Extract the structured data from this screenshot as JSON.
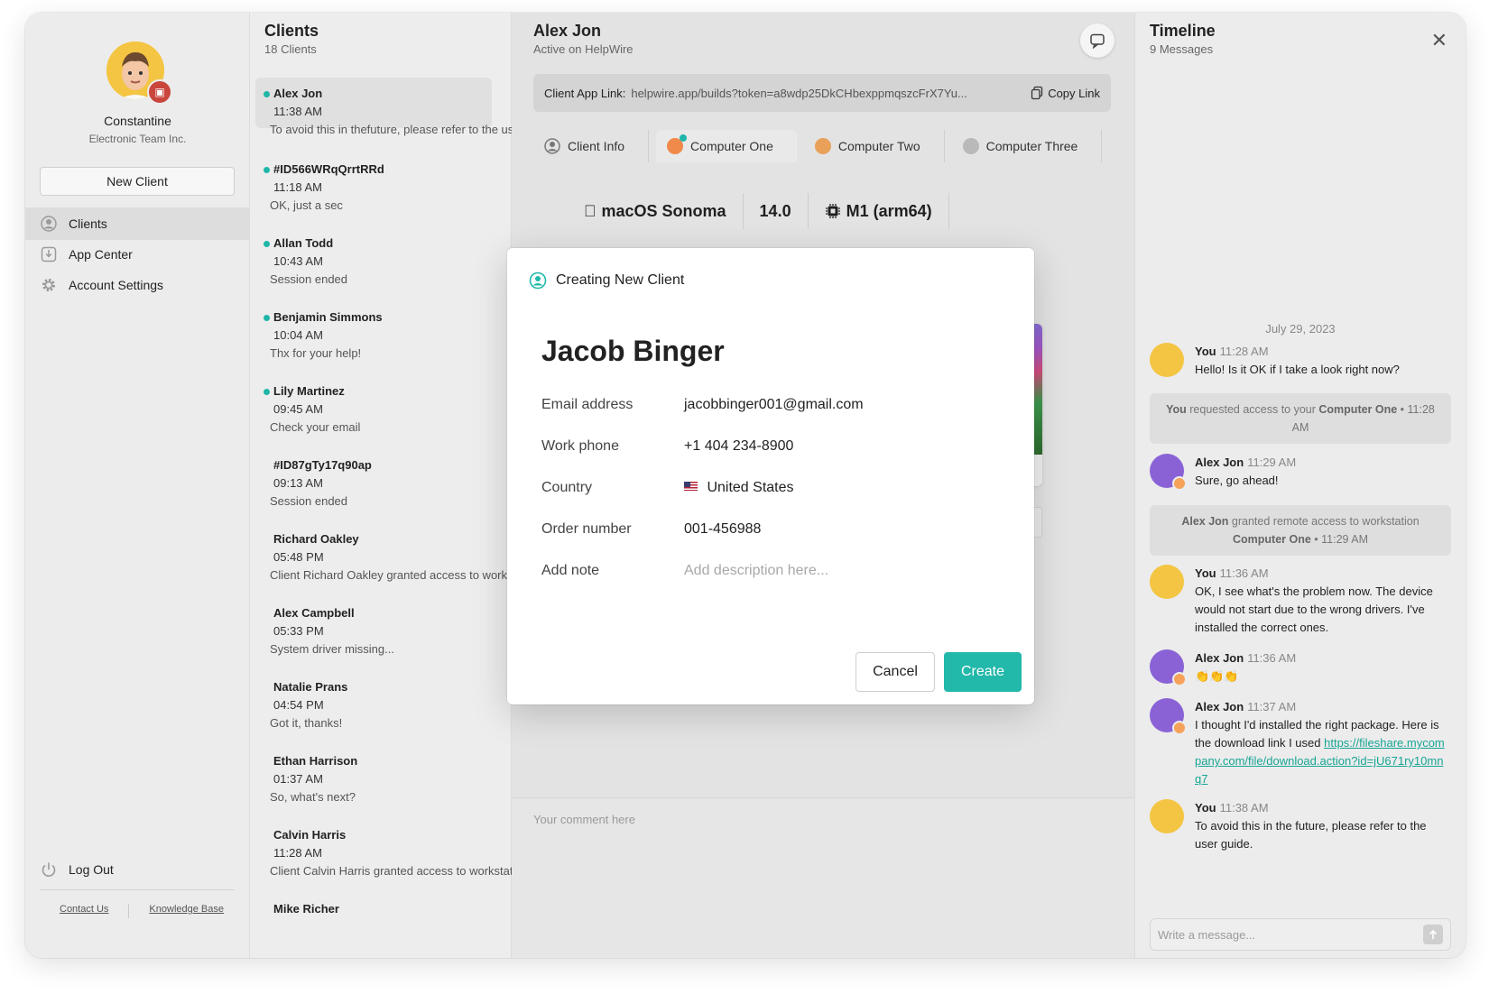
{
  "profile": {
    "name": "Constantine",
    "org": "Electronic Team Inc."
  },
  "sidebar": {
    "new_client": "New Client",
    "nav": [
      {
        "label": "Clients",
        "icon": "user-circle-icon"
      },
      {
        "label": "App Center",
        "icon": "download-icon"
      },
      {
        "label": "Account Settings",
        "icon": "gear-icon"
      }
    ],
    "logout": "Log Out",
    "footer": {
      "contact": "Contact Us",
      "kb": "Knowledge Base"
    }
  },
  "clients": {
    "title": "Clients",
    "count": "18 Clients",
    "items": [
      {
        "name": "Alex Jon",
        "time": "11:38 AM",
        "msg": "To avoid this in thefuture, please refer to the user guide",
        "online": true
      },
      {
        "name": "#ID566WRqQrrtRRd",
        "time": "11:18 AM",
        "msg": "OK, just a sec",
        "online": true
      },
      {
        "name": "Allan Todd",
        "time": "10:43 AM",
        "msg": "Session ended",
        "online": true
      },
      {
        "name": "Benjamin Simmons",
        "time": "10:04 AM",
        "msg": "Thx for your help!",
        "online": true
      },
      {
        "name": "Lily Martinez",
        "time": "09:45 AM",
        "msg": "Check your email",
        "online": true
      },
      {
        "name": "#ID87gTy17q90ap",
        "time": "09:13 AM",
        "msg": "Session ended",
        "online": false
      },
      {
        "name": "Richard Oakley",
        "time": "05:48 PM",
        "msg": "Client Richard Oakley granted access to workstation",
        "online": false
      },
      {
        "name": "Alex Campbell",
        "time": "05:33 PM",
        "msg": "System driver missing...",
        "online": false
      },
      {
        "name": "Natalie Prans",
        "time": "04:54 PM",
        "msg": "Got it, thanks!",
        "online": false
      },
      {
        "name": "Ethan Harrison",
        "time": "01:37 AM",
        "msg": "So, what's next?",
        "online": false
      },
      {
        "name": "Calvin Harris",
        "time": "11:28 AM",
        "msg": "Client Calvin Harris granted access to workstation",
        "online": false
      },
      {
        "name": "Mike Richer",
        "time": "",
        "msg": "",
        "online": false
      }
    ]
  },
  "main": {
    "name": "Alex Jon",
    "status": "Active on HelpWire",
    "link_label": "Client App Link:",
    "link_url": "helpwire.app/builds?token=a8wdp25DkCHbexppmqszcFrX7Yu...",
    "copy": "Copy Link",
    "tabs": [
      "Client Info",
      "Computer One",
      "Computer Two",
      "Computer Three"
    ],
    "specs": {
      "os": "macOS Sonoma",
      "version": "14.0",
      "chip": "M1 (arm64)"
    },
    "comment_placeholder": "Your comment here"
  },
  "modal": {
    "header": "Creating New Client",
    "name": "Jacob Binger",
    "fields": [
      {
        "label": "Email address",
        "value": "jacobbinger001@gmail.com"
      },
      {
        "label": "Work phone",
        "value": "+1 404 234-8900"
      },
      {
        "label": "Country",
        "value": "United States",
        "flag": "🇺🇸"
      },
      {
        "label": "Order number",
        "value": "001-456988"
      },
      {
        "label": "Add note",
        "placeholder": "Add description here..."
      }
    ],
    "cancel": "Cancel",
    "create": "Create"
  },
  "timeline": {
    "title": "Timeline",
    "count": "9 Messages",
    "date": "July 29, 2023",
    "messages": [
      {
        "who": "You",
        "time": "11:28 AM",
        "text": "Hello! Is it OK if I take a look right now?"
      },
      {
        "sys_pre": "You",
        "sys_mid": " requested access to your ",
        "sys_b": "Computer One",
        "sys_post": " • 11:28 AM"
      },
      {
        "who": "Alex Jon",
        "time": "11:29 AM",
        "text": "Sure, go ahead!"
      },
      {
        "sys_pre": "Alex Jon",
        "sys_mid": " granted remote access to workstation ",
        "sys_b": "Computer One",
        "sys_post": " • 11:29 AM"
      },
      {
        "who": "You",
        "time": "11:36 AM",
        "text": "OK, I see what's the problem now. The device would not start due to the wrong drivers. I've installed the correct ones."
      },
      {
        "who": "Alex Jon",
        "time": "11:36 AM",
        "text": "👏👏👏"
      },
      {
        "who": "Alex Jon",
        "time": "11:37 AM",
        "text": "I thought I'd installed the right package. Here is the download link I used ",
        "link": "https://fileshare.mycompany.com/file/download.action?id=jU671ry10mnq7"
      },
      {
        "who": "You",
        "time": "11:38 AM",
        "text": "To avoid this in the future, please refer to the user guide."
      }
    ],
    "write_placeholder": "Write a message..."
  },
  "colors": {
    "accent": "#22b8aa",
    "online": "#1fb6a8",
    "alert": "#c9463d"
  }
}
